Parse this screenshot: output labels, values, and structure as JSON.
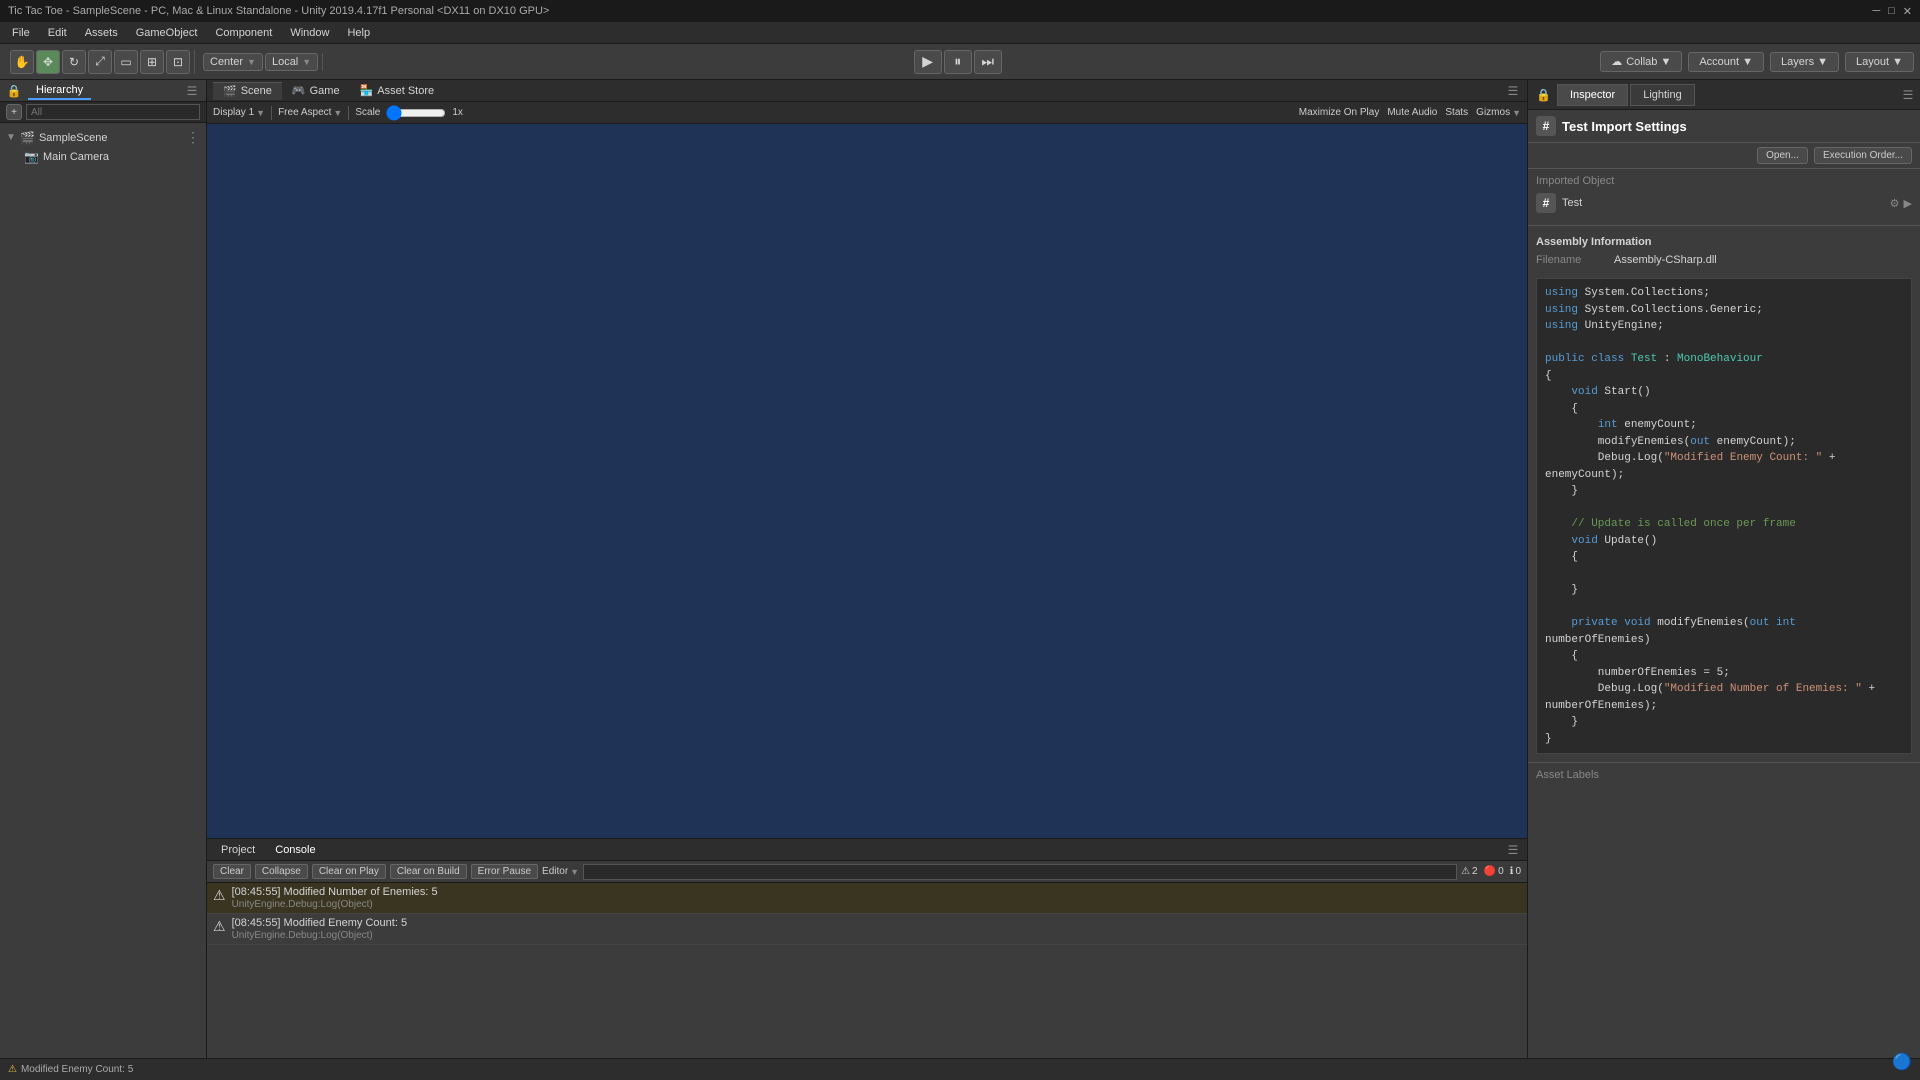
{
  "window": {
    "title": "Tic Tac Toe - SampleScene - PC, Mac & Linux Standalone - Unity 2019.4.17f1 Personal <DX11 on DX10 GPU>"
  },
  "menu": {
    "items": [
      "File",
      "Edit",
      "Assets",
      "GameObject",
      "Component",
      "Window",
      "Help"
    ]
  },
  "toolbar": {
    "transform_tools": [
      "hand",
      "move",
      "rotate",
      "scale",
      "rect",
      "multi"
    ],
    "pivot_label": "Center",
    "space_label": "Local",
    "play_btn": "▶",
    "pause_btn": "⏸",
    "step_btn": "⏭",
    "collab_label": "Collab ▼",
    "account_label": "Account ▼",
    "layers_label": "Layers ▼",
    "layout_label": "Layout ▼"
  },
  "hierarchy": {
    "tab_label": "Hierarchy",
    "search_placeholder": "All",
    "items": [
      {
        "label": "SampleScene",
        "level": 0,
        "expanded": true,
        "icon": "🎬"
      },
      {
        "label": "Main Camera",
        "level": 1,
        "icon": "📷"
      }
    ]
  },
  "scene_tabs": [
    {
      "label": "Scene",
      "icon": "🎬",
      "active": false
    },
    {
      "label": "Game",
      "icon": "🎮",
      "active": false
    },
    {
      "label": "Asset Store",
      "icon": "🏪",
      "active": false
    }
  ],
  "scene_toolbar": {
    "display_label": "Display 1",
    "aspect_label": "Free Aspect",
    "scale_label": "Scale",
    "scale_value": "1x",
    "maximize_label": "Maximize On Play",
    "mute_label": "Mute Audio",
    "stats_label": "Stats",
    "gizmos_label": "Gizmos"
  },
  "console": {
    "project_tab": "Project",
    "console_tab": "Console",
    "clear_btn": "Clear",
    "collapse_btn": "Collapse",
    "clear_on_play_btn": "Clear on Play",
    "clear_on_build_btn": "Clear on Build",
    "error_pause_btn": "Error Pause",
    "editor_btn": "Editor",
    "search_placeholder": "",
    "warning_count": "2",
    "error_count": "0",
    "log_count": "0",
    "entries": [
      {
        "type": "warning",
        "message": "[08:45:55] Modified Number of Enemies: 5",
        "stack": "UnityEngine.Debug:Log(Object)"
      },
      {
        "type": "warning",
        "message": "[08:45:55] Modified Enemy Count: 5",
        "stack": "UnityEngine.Debug:Log(Object)"
      }
    ]
  },
  "inspector": {
    "inspector_tab": "Inspector",
    "lighting_tab": "Lighting",
    "title": "Test Import Settings",
    "open_btn": "Open...",
    "exec_order_btn": "Execution Order...",
    "imported_object_label": "Imported Object",
    "object_name": "Test",
    "hash_symbol": "#",
    "assembly_info": {
      "title": "Assembly Information",
      "filename_label": "Filename",
      "filename_value": "Assembly-CSharp.dll"
    },
    "code": [
      "using System.Collections;",
      "using System.Collections.Generic;",
      "using UnityEngine;",
      "",
      "public class Test : MonoBehaviour",
      "{",
      "    void Start()",
      "    {",
      "        int enemyCount;",
      "        modifyEnemies(out enemyCount);",
      "        Debug.Log(\"Modified Enemy Count: \" + enemyCount);",
      "    }",
      "",
      "    // Update is called once per frame",
      "    void Update()",
      "    {",
      "",
      "    }",
      "",
      "    private void modifyEnemies(out int numberOfEnemies)",
      "    {",
      "        numberOfEnemies = 5;",
      "        Debug.Log(\"Modified Number of Enemies: \" + numberOfEnemies);",
      "    }",
      "}"
    ],
    "asset_labels_title": "Asset Labels"
  },
  "status_bar": {
    "message": "Modified Enemy Count: 5"
  }
}
